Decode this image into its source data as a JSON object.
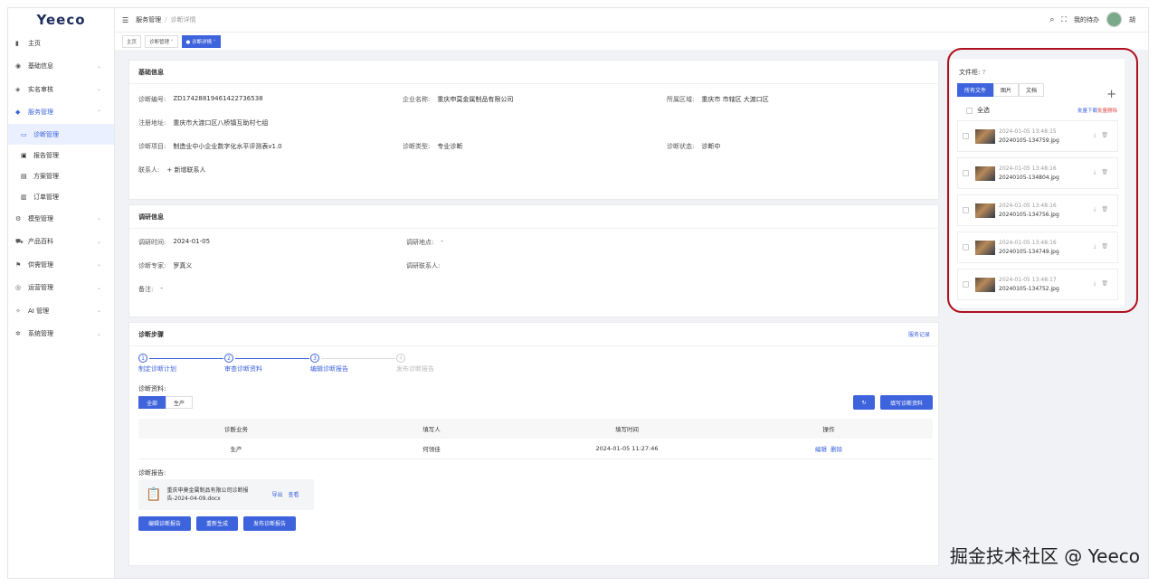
{
  "logo": "Yeeco",
  "sidebar": {
    "items": [
      {
        "icon": "chart-icon",
        "label": "主页"
      },
      {
        "icon": "globe-icon",
        "label": "基础信息"
      },
      {
        "icon": "verify-icon",
        "label": "实名审核"
      },
      {
        "icon": "service-icon",
        "label": "服务管理"
      }
    ],
    "sub": [
      {
        "label": "诊断管理"
      },
      {
        "label": "报告管理"
      },
      {
        "label": "方案管理"
      },
      {
        "label": "订单管理"
      }
    ],
    "items2": [
      {
        "label": "模型管理"
      },
      {
        "label": "产品百科"
      },
      {
        "label": "供需管理"
      },
      {
        "label": "运营管理"
      },
      {
        "label": "AI 管理"
      },
      {
        "label": "系统管理"
      }
    ]
  },
  "topbar": {
    "crumb1": "服务管理",
    "sep": "/",
    "crumb2": "诊断详情",
    "todo": "我的待办",
    "user": "胡"
  },
  "tags": [
    "主页",
    "诊断管理",
    "诊断详情"
  ],
  "basic": {
    "title": "基础信息",
    "code_k": "诊断编号:",
    "code_v": "ZD17428819461422736538",
    "ent_k": "企业名称:",
    "ent_v": "重庆申莫金属制品有限公司",
    "area_k": "所属区域:",
    "area_v": "重庆市 市辖区 大渡口区",
    "addr_k": "注册地址:",
    "addr_v": "重庆市大渡口区八桥镇互助村七组",
    "proj_k": "诊断项目:",
    "proj_v": "制造业中小企业数字化水平评测表v1.0",
    "type_k": "诊断类型:",
    "type_v": "专业诊断",
    "status_k": "诊断状态:",
    "status_v": "诊断中",
    "contact_k": "联系人:",
    "contact_v": "+ 新增联系人"
  },
  "research": {
    "title": "调研信息",
    "time_k": "调研时间:",
    "time_v": "2024-01-05",
    "place_k": "调研地点:",
    "place_v": "-",
    "expert_k": "诊断专家:",
    "expert_v": "罗真义",
    "contact_k": "调研联系人:",
    "contact_v": "",
    "note_k": "备注:",
    "note_v": "-"
  },
  "steps": {
    "title": "诊断步骤",
    "link": "服务记录",
    "list": [
      {
        "n": "1",
        "t": "制定诊断计划"
      },
      {
        "n": "2",
        "t": "审查诊断资料"
      },
      {
        "n": "3",
        "t": "编辑诊断报告"
      },
      {
        "n": "4",
        "t": "发布诊断报告"
      }
    ],
    "materials_label": "诊断资料:",
    "seg_all": "全部",
    "seg_prod": "生产",
    "refresh": "↻",
    "fill_btn": "填写诊断资料",
    "cols": [
      "诊断业务",
      "填写人",
      "填写时间",
      "操作"
    ],
    "rows": [
      {
        "biz": "生产",
        "person": "何领佳",
        "time": "2024-01-05 11:27:46",
        "edit": "编辑",
        "del": "删除"
      }
    ],
    "report_label": "诊断报告:",
    "report_file": "重庆申莫金属制品有限公司诊断报告-2024-04-09.docx",
    "export": "导出",
    "view": "查看",
    "btn_edit": "编辑诊断报告",
    "btn_regen": "重新生成",
    "btn_pub": "发布诊断报告"
  },
  "files": {
    "title": "文件柜:",
    "tabs": [
      "所有文件",
      "图片",
      "文档"
    ],
    "all": "全选",
    "batch_dl": "批量下载",
    "batch_del": "批量删除",
    "items": [
      {
        "date": "2024-01-05 13:48:15",
        "name": "20240105-134759.jpg"
      },
      {
        "date": "2024-01-05 13:48:16",
        "name": "20240105-134804.jpg"
      },
      {
        "date": "2024-01-05 13:48:16",
        "name": "20240105-134756.jpg"
      },
      {
        "date": "2024-01-05 13:48:16",
        "name": "20240105-134749.jpg"
      },
      {
        "date": "2024-01-05 13:48:17",
        "name": "20240105-134752.jpg"
      }
    ]
  },
  "watermark": "掘金技术社区 @ Yeeco",
  "colors": {
    "accent": "#3d63dd",
    "highlight": "#b0101e"
  }
}
